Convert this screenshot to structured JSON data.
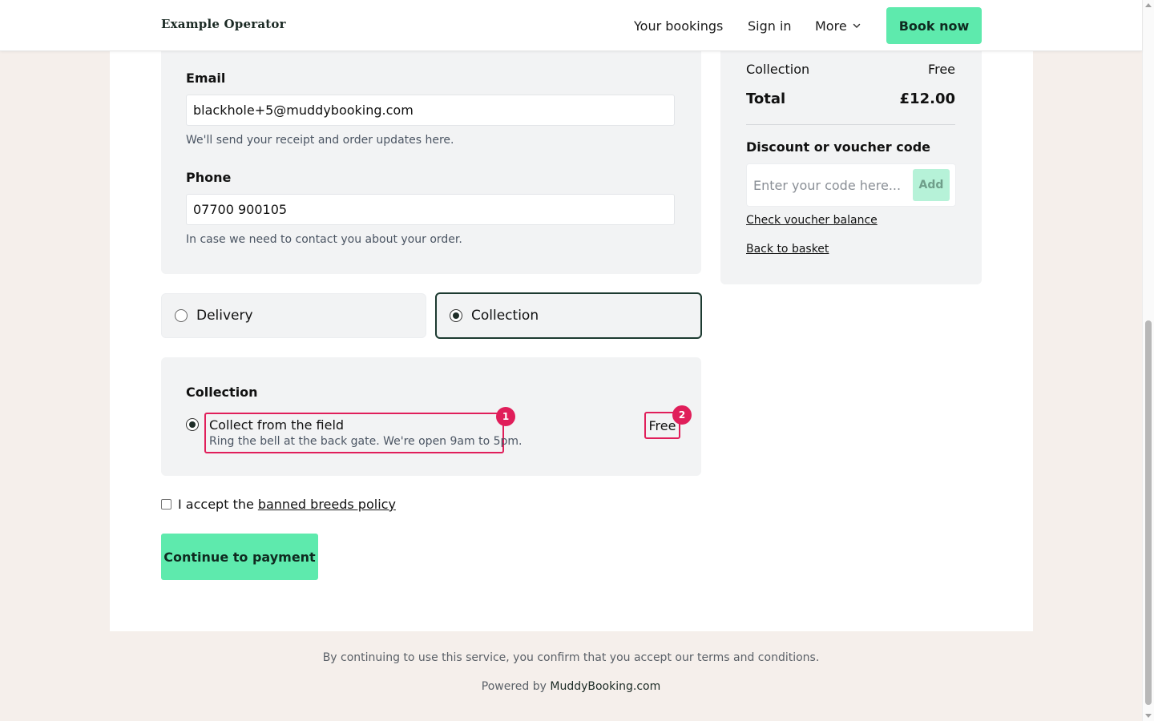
{
  "header": {
    "brand": "Example Operator",
    "nav": {
      "bookings": "Your bookings",
      "signin": "Sign in",
      "more": "More"
    },
    "book_now": "Book now"
  },
  "contact": {
    "email_label": "Email",
    "email_value": "blackhole+5@muddybooking.com",
    "email_hint": "We'll send your receipt and order updates here.",
    "phone_label": "Phone",
    "phone_value": "07700 900105",
    "phone_hint": "In case we need to contact you about your order."
  },
  "fulfilment": {
    "delivery_label": "Delivery",
    "collection_label": "Collection",
    "selected": "Collection"
  },
  "collection_card": {
    "title": "Collection",
    "option_name": "Collect from the field",
    "option_desc": "Ring the bell at the back gate. We're open 9am to 5pm.",
    "price": "Free",
    "badge_1": "1",
    "badge_2": "2"
  },
  "policy": {
    "prefix": "I accept the",
    "link": "banned breeds policy"
  },
  "continue_label": "Continue to payment",
  "summary": {
    "collection_label": "Collection",
    "collection_value": "Free",
    "total_label": "Total",
    "total_value": "£12.00",
    "discount_title": "Discount or voucher code",
    "discount_placeholder": "Enter your code here...",
    "add_label": "Add",
    "check_balance": "Check voucher balance",
    "back_to_basket": "Back to basket"
  },
  "footer": {
    "terms": "By continuing to use this service, you confirm that you accept our terms and conditions.",
    "powered_prefix": "Powered by",
    "powered_link": "MuddyBooking.com"
  },
  "colors": {
    "accent": "#5eeaad",
    "highlight": "#e01e5a",
    "dark_green": "#1c3a30",
    "page_bg": "#f5efeb"
  }
}
